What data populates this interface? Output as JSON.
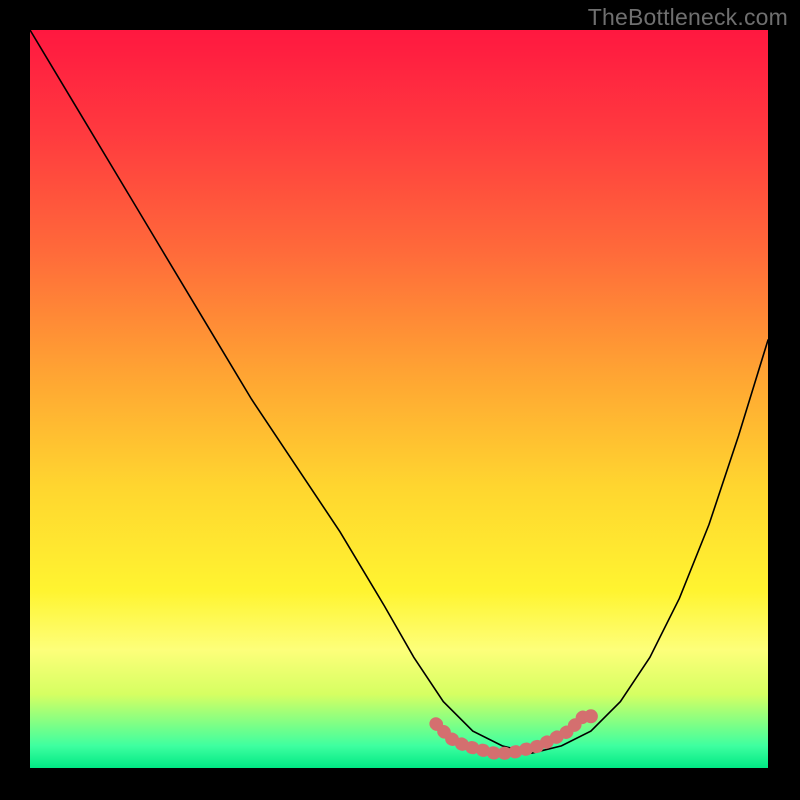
{
  "watermark": "TheBottleneck.com",
  "chart_data": {
    "type": "line",
    "title": "",
    "xlabel": "",
    "ylabel": "",
    "xlim": [
      0,
      100
    ],
    "ylim": [
      0,
      100
    ],
    "grid": false,
    "legend": false,
    "background": "rainbow-vertical-gradient",
    "series": [
      {
        "name": "bottleneck-curve",
        "color": "#000000",
        "x": [
          0,
          6,
          12,
          18,
          24,
          30,
          36,
          42,
          48,
          52,
          56,
          60,
          64,
          68,
          72,
          76,
          80,
          84,
          88,
          92,
          96,
          100
        ],
        "y": [
          100,
          90,
          80,
          70,
          60,
          50,
          41,
          32,
          22,
          15,
          9,
          5,
          3,
          2,
          3,
          5,
          9,
          15,
          23,
          33,
          45,
          58
        ]
      },
      {
        "name": "valley-highlight",
        "color": "#d46f6f",
        "style": "thick-dots",
        "x": [
          55,
          57,
          59,
          61,
          63,
          65,
          67,
          69,
          71,
          73,
          75
        ],
        "y": [
          6,
          4,
          3,
          2.5,
          2,
          2,
          2.5,
          3,
          4,
          5,
          7
        ]
      }
    ],
    "annotations": [
      {
        "type": "dot",
        "x": 76,
        "y": 7,
        "color": "#d46f6f"
      }
    ]
  }
}
